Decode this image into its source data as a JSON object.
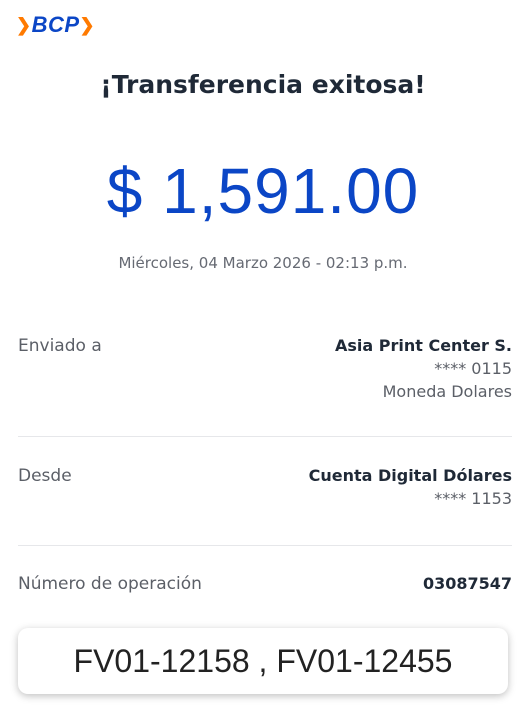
{
  "brand": {
    "name": "BCP"
  },
  "title": "¡Transferencia exitosa!",
  "amount": "$ 1,591.00",
  "date": "Miércoles, 04 Marzo 2026 - 02:13 p.m.",
  "details": {
    "sent_to": {
      "label": "Enviado a",
      "name": "Asia Print Center S.",
      "account": "**** 0115",
      "currency": "Moneda Dolares"
    },
    "from": {
      "label": "Desde",
      "name": "Cuenta Digital Dólares",
      "account": "**** 1153"
    },
    "operation": {
      "label": "Número de operación",
      "number": "03087547"
    }
  },
  "overlay_note": "FV01-12158 , FV01-12455",
  "colors": {
    "brand_blue": "#0b46c6",
    "brand_orange": "#ff7a00"
  }
}
